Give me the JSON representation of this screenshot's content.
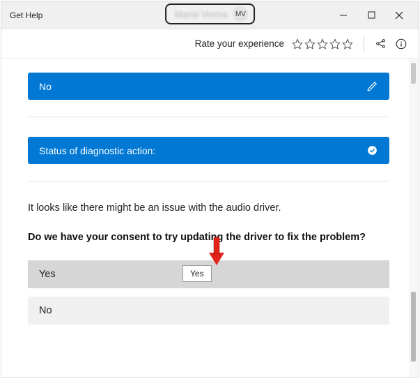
{
  "app": {
    "title": "Get Help"
  },
  "profile": {
    "name": "Mansi Verma",
    "initials": "MV"
  },
  "toolbar": {
    "rate_label": "Rate your experience"
  },
  "previous_answer": {
    "label": "No"
  },
  "diagnostic": {
    "status_label": "Status of diagnostic action:"
  },
  "body": {
    "issue_text": "It looks like there might be an issue with the audio driver.",
    "consent_question": "Do we have your consent to try updating the driver to fix the problem?"
  },
  "options": {
    "yes": "Yes",
    "no": "No"
  },
  "tooltip": {
    "text": "Yes"
  }
}
